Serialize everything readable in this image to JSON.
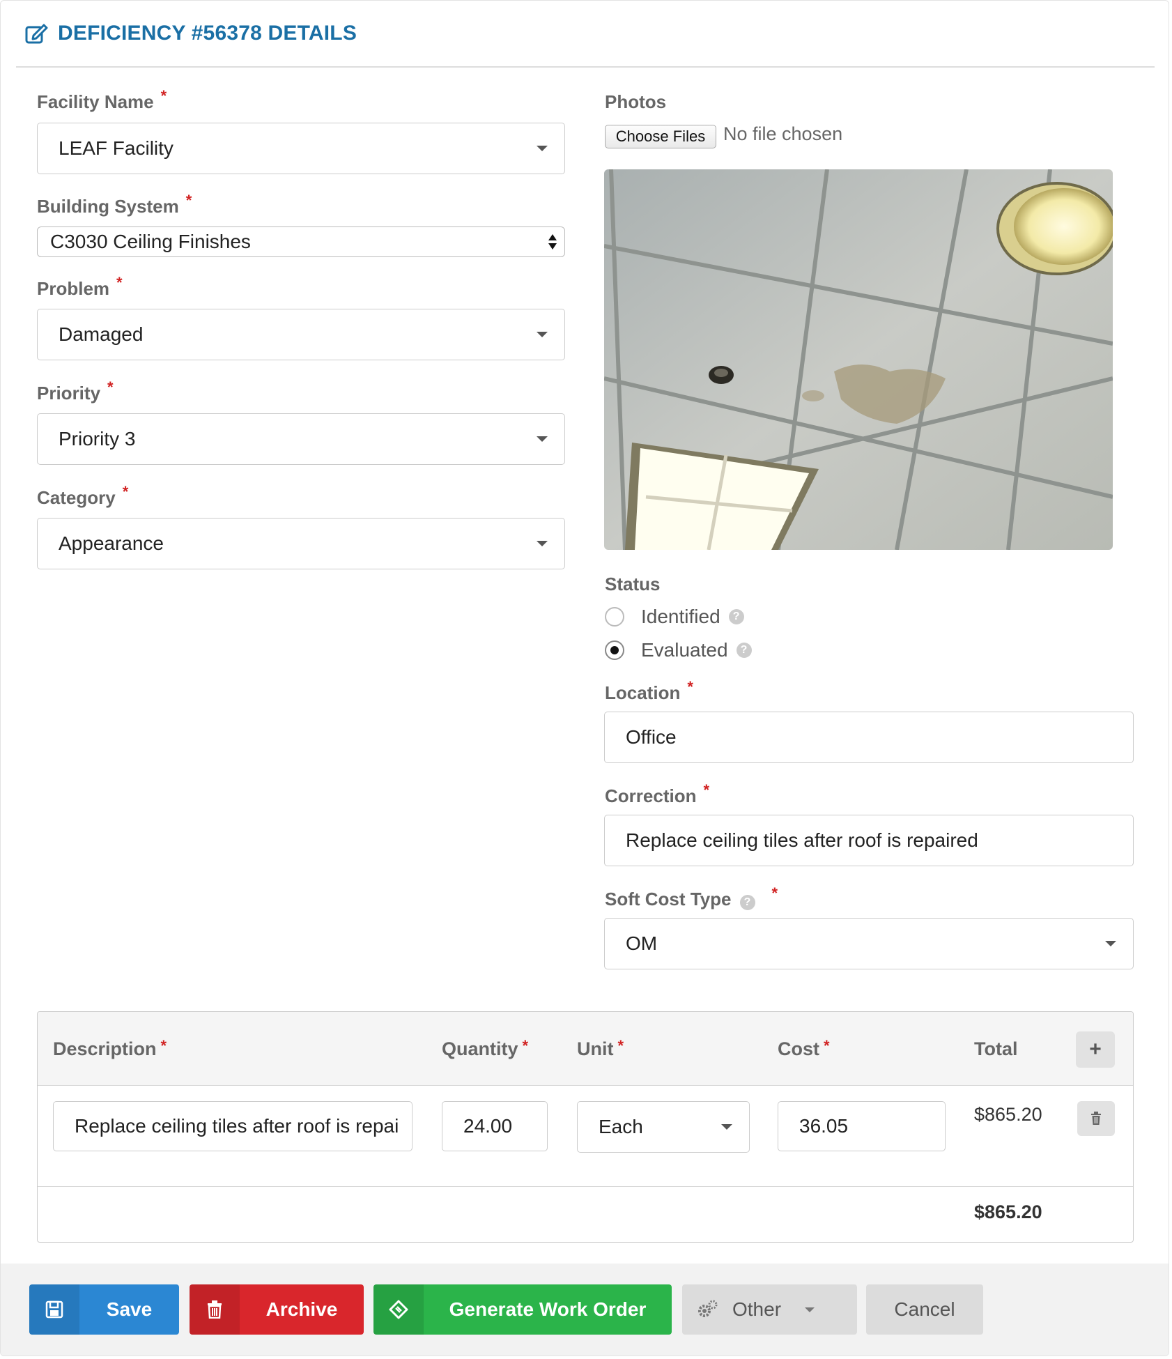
{
  "header": {
    "title": "DEFICIENCY #56378 DETAILS"
  },
  "form": {
    "facility_name": {
      "label": "Facility Name",
      "value": "LEAF Facility"
    },
    "building_system": {
      "label": "Building System",
      "value": "C3030 Ceiling Finishes"
    },
    "problem": {
      "label": "Problem",
      "value": "Damaged"
    },
    "priority": {
      "label": "Priority",
      "value": "Priority 3"
    },
    "category": {
      "label": "Category",
      "value": "Appearance"
    },
    "required_mark": "*"
  },
  "photos": {
    "label": "Photos",
    "choose_files_label": "Choose Files",
    "no_file_text": "No file chosen"
  },
  "status": {
    "label": "Status",
    "options": [
      {
        "label": "Identified",
        "checked": false
      },
      {
        "label": "Evaluated",
        "checked": true
      }
    ],
    "help_glyph": "?"
  },
  "location": {
    "label": "Location",
    "value": "Office"
  },
  "correction": {
    "label": "Correction",
    "value": "Replace ceiling tiles after roof is repaired"
  },
  "soft_cost_type": {
    "label": "Soft Cost Type",
    "value": "OM"
  },
  "cost_table": {
    "headers": {
      "description": "Description",
      "quantity": "Quantity",
      "unit": "Unit",
      "cost": "Cost",
      "total": "Total"
    },
    "add_label": "+",
    "rows": [
      {
        "description": "Replace ceiling tiles after roof is repai",
        "quantity": "24.00",
        "unit": "Each",
        "cost": "36.05",
        "total": "$865.20"
      }
    ],
    "grand_total": "$865.20"
  },
  "footer": {
    "save": "Save",
    "archive": "Archive",
    "generate": "Generate Work Order",
    "other": "Other",
    "cancel": "Cancel"
  },
  "colors": {
    "title": "#1a6fa5",
    "save": "#2b87d3",
    "archive": "#d9262c",
    "generate": "#2bb44a",
    "required": "#d12222"
  },
  "icons": [
    "edit-icon",
    "caret-down-icon",
    "updown-icon",
    "help-icon",
    "plus-icon",
    "trash-icon",
    "floppy-icon",
    "ticket-icon",
    "cogs-icon"
  ]
}
